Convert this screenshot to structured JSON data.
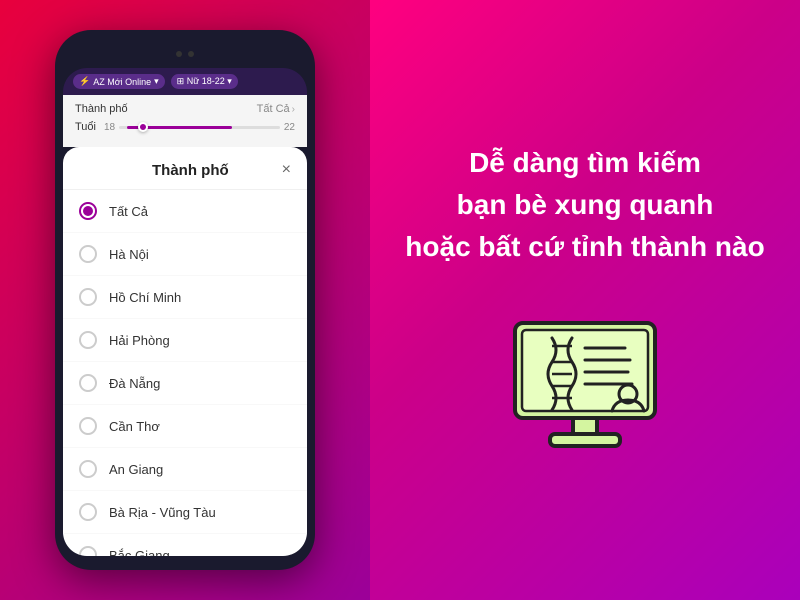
{
  "left": {
    "topbar": {
      "badge_label": "AZ  Mới Online",
      "filter_label": "Nữ 18-22"
    },
    "filter_panel": {
      "city_label": "Thành phố",
      "city_value": "Tất Cả",
      "age_label": "Tuổi",
      "age_min": "18",
      "age_max": "22"
    },
    "modal": {
      "title": "Thành phố",
      "close_label": "×",
      "items": [
        {
          "label": "Tất Cả",
          "selected": true
        },
        {
          "label": "Hà Nội",
          "selected": false
        },
        {
          "label": "Hồ Chí Minh",
          "selected": false
        },
        {
          "label": "Hải Phòng",
          "selected": false
        },
        {
          "label": "Đà Nẵng",
          "selected": false
        },
        {
          "label": "Cần Thơ",
          "selected": false
        },
        {
          "label": "An Giang",
          "selected": false
        },
        {
          "label": "Bà Rịa - Vũng Tàu",
          "selected": false
        },
        {
          "label": "Bắc Giang",
          "selected": false
        }
      ]
    }
  },
  "right": {
    "text_line1": "Dễ dàng tìm kiếm",
    "text_line2": "bạn bè xung quanh",
    "text_line3": "hoặc bất cứ tỉnh thành nào"
  },
  "colors": {
    "accent": "#9b0099",
    "bg_left": "#c0006a",
    "bg_right": "#dd0088"
  }
}
